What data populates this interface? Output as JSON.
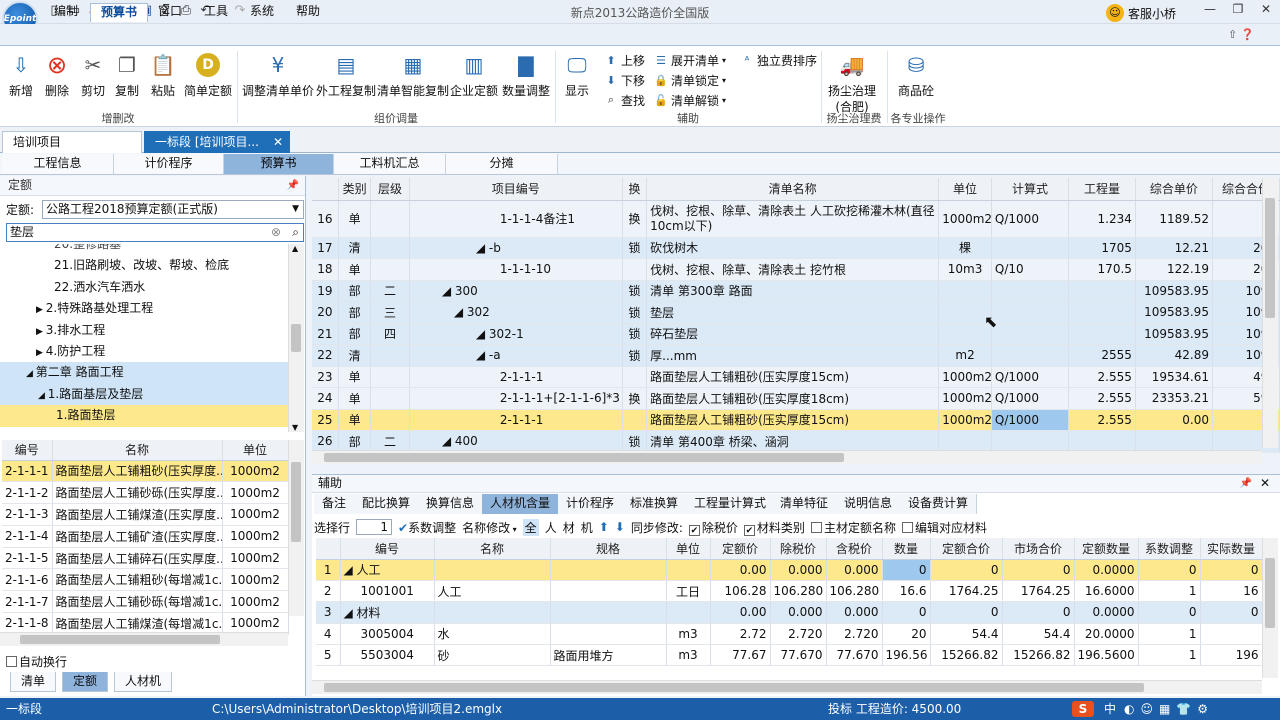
{
  "app": {
    "title": "新点2013公路造价全国版",
    "logo": "Epoint",
    "service": "客服小桥"
  },
  "menus": [
    "编制",
    "预算书",
    "窗口",
    "工具",
    "系统",
    "帮助"
  ],
  "ribbon": {
    "group1": {
      "label": "增删改",
      "buttons": [
        "新增",
        "删除",
        "剪切",
        "复制",
        "粘贴",
        "简单定额"
      ]
    },
    "group2": {
      "label": "组价调量",
      "buttons": [
        "调整清单单价",
        "外工程复制",
        "清单智能复制",
        "企业定额",
        "数量调整"
      ]
    },
    "group3": {
      "label": "辅助",
      "display": "显示",
      "small": [
        "上移",
        "下移",
        "查找",
        "展开清单",
        "清单锁定",
        "清单解锁",
        "独立费排序"
      ]
    },
    "group4": {
      "label": "扬尘治理费",
      "button": "扬尘治理",
      "button2": "(合肥)"
    },
    "group5": {
      "label": "各专业操作",
      "button": "商品砼"
    }
  },
  "doctabs": [
    "培训项目",
    "一标段 [培训项目..."
  ],
  "subtabs": [
    "工程信息",
    "计价程序",
    "预算书",
    "工料机汇总",
    "分摊"
  ],
  "left": {
    "panel_title": "定额",
    "quota_label": "定额:",
    "quota_value": "公路工程2018预算定额(正式版)",
    "search_value": "垫层",
    "tree": [
      "20.整修路基",
      "21.旧路刷坡、改坡、帮坡、检底",
      "22.洒水汽车洒水",
      "2.特殊路基处理工程",
      "3.排水工程",
      "4.防护工程",
      "第二章 路面工程",
      "1.路面基层及垫层",
      "1.路面垫层"
    ],
    "list_headers": [
      "编号",
      "名称",
      "单位"
    ],
    "list": [
      [
        "2-1-1-1",
        "路面垫层人工铺粗砂(压实厚度...",
        "1000m2"
      ],
      [
        "2-1-1-2",
        "路面垫层人工铺砂砾(压实厚度...",
        "1000m2"
      ],
      [
        "2-1-1-3",
        "路面垫层人工铺煤渣(压实厚度...",
        "1000m2"
      ],
      [
        "2-1-1-4",
        "路面垫层人工铺矿渣(压实厚度...",
        "1000m2"
      ],
      [
        "2-1-1-5",
        "路面垫层人工铺碎石(压实厚度...",
        "1000m2"
      ],
      [
        "2-1-1-6",
        "路面垫层人工铺粗砂(每增减1c...",
        "1000m2"
      ],
      [
        "2-1-1-7",
        "路面垫层人工铺砂砾(每增减1c...",
        "1000m2"
      ],
      [
        "2-1-1-8",
        "路面垫层人工铺煤渣(每增减1c...",
        "1000m2"
      ]
    ],
    "auto_wrap": "自动换行",
    "bottom_tabs": [
      "清单",
      "定额",
      "人材机"
    ]
  },
  "main": {
    "headers": [
      "",
      "类别",
      "层级",
      "项目编号",
      "换",
      "清单名称",
      "单位",
      "计算式",
      "工程量",
      "综合单价",
      "综合合价"
    ],
    "rows": [
      [
        "16",
        "单",
        "",
        "1-1-1-4备注1",
        "换",
        "伐树、挖根、除草、清除表土 人工砍挖稀灌木林(直径10cm以下)",
        "1000m2",
        "Q/1000",
        "1.234",
        "1189.52",
        "14"
      ],
      [
        "17",
        "清",
        "",
        "◢ -b",
        "锁",
        "砍伐树木",
        "棵",
        "",
        "1705",
        "12.21",
        "208"
      ],
      [
        "18",
        "单",
        "",
        "1-1-1-10",
        "",
        "伐树、挖根、除草、清除表土 挖竹根",
        "10m3",
        "Q/10",
        "170.5",
        "122.19",
        "208"
      ],
      [
        "19",
        "部",
        "二",
        "◢ 300",
        "锁",
        "清单 第300章 路面",
        "",
        "",
        "",
        "109583.95",
        "1095"
      ],
      [
        "20",
        "部",
        "三",
        "◢ 302",
        "锁",
        "垫层",
        "",
        "",
        "",
        "109583.95",
        "1095"
      ],
      [
        "21",
        "部",
        "四",
        "◢ 302-1",
        "锁",
        "碎石垫层",
        "",
        "",
        "",
        "109583.95",
        "1095"
      ],
      [
        "22",
        "清",
        "",
        "◢ -a",
        "锁",
        "厚...mm",
        "m2",
        "",
        "2555",
        "42.89",
        "1095"
      ],
      [
        "23",
        "单",
        "",
        "2-1-1-1",
        "",
        "路面垫层人工铺粗砂(压实厚度15cm)",
        "1000m2",
        "Q/1000",
        "2.555",
        "19534.61",
        "499"
      ],
      [
        "24",
        "单",
        "",
        "2-1-1-1+[2-1-1-6]*3",
        "换",
        "路面垫层人工铺粗砂(压实厚度18cm)",
        "1000m2",
        "Q/1000",
        "2.555",
        "23353.21",
        "596"
      ],
      [
        "25",
        "单",
        "",
        "2-1-1-1",
        "",
        "路面垫层人工铺粗砂(压实厚度15cm)",
        "1000m2",
        "Q/1000",
        "2.555",
        "0.00",
        "0"
      ],
      [
        "26",
        "部",
        "二",
        "◢ 400",
        "锁",
        "清单 第400章 桥梁、涵洞",
        "",
        "",
        "",
        "",
        ""
      ]
    ]
  },
  "assist": {
    "title": "辅助",
    "tabs": [
      "备注",
      "配比换算",
      "换算信息",
      "人材机含量",
      "计价程序",
      "标准换算",
      "工程量计算式",
      "清单特征",
      "说明信息",
      "设备费计算"
    ],
    "toolbar": {
      "select_row": "选择行",
      "row_value": "1",
      "coef_adjust": "系数调整",
      "name_modify": "名称修改",
      "filters": [
        "全",
        "人",
        "材",
        "机"
      ],
      "sync_label": "同步修改:",
      "opt1": "除税价",
      "opt2": "材料类别",
      "opt3": "主材定额名称",
      "opt4": "编辑对应材料"
    },
    "headers": [
      "",
      "编号",
      "名称",
      "规格",
      "单位",
      "定额价",
      "除税价",
      "含税价",
      "数量",
      "定额合价",
      "市场合价",
      "定额数量",
      "系数调整",
      "实际数量"
    ],
    "rows": [
      [
        "1",
        "◢ 人工",
        "",
        "",
        "",
        "0.00",
        "0.000",
        "0.000",
        "0",
        "0",
        "0",
        "0.0000",
        "0",
        "0"
      ],
      [
        "2",
        "1001001",
        "人工",
        "",
        "工日",
        "106.28",
        "106.280",
        "106.280",
        "16.6",
        "1764.25",
        "1764.25",
        "16.6000",
        "1",
        "16"
      ],
      [
        "3",
        "◢ 材料",
        "",
        "",
        "",
        "0.00",
        "0.000",
        "0.000",
        "0",
        "0",
        "0",
        "0.0000",
        "0",
        "0"
      ],
      [
        "4",
        "3005004",
        "水",
        "",
        "m3",
        "2.72",
        "2.720",
        "2.720",
        "20",
        "54.4",
        "54.4",
        "20.0000",
        "1",
        ""
      ],
      [
        "5",
        "5503004",
        "砂",
        "路面用堆方",
        "m3",
        "77.67",
        "77.670",
        "77.670",
        "196.56",
        "15266.82",
        "15266.82",
        "196.5600",
        "1",
        "196"
      ]
    ]
  },
  "status": {
    "left": "一标段",
    "path": "C:\\Users\\Administrator\\Desktop\\培训项目2.emglx",
    "right": "投标 工程造价: 4500.00",
    "ime": "中"
  }
}
